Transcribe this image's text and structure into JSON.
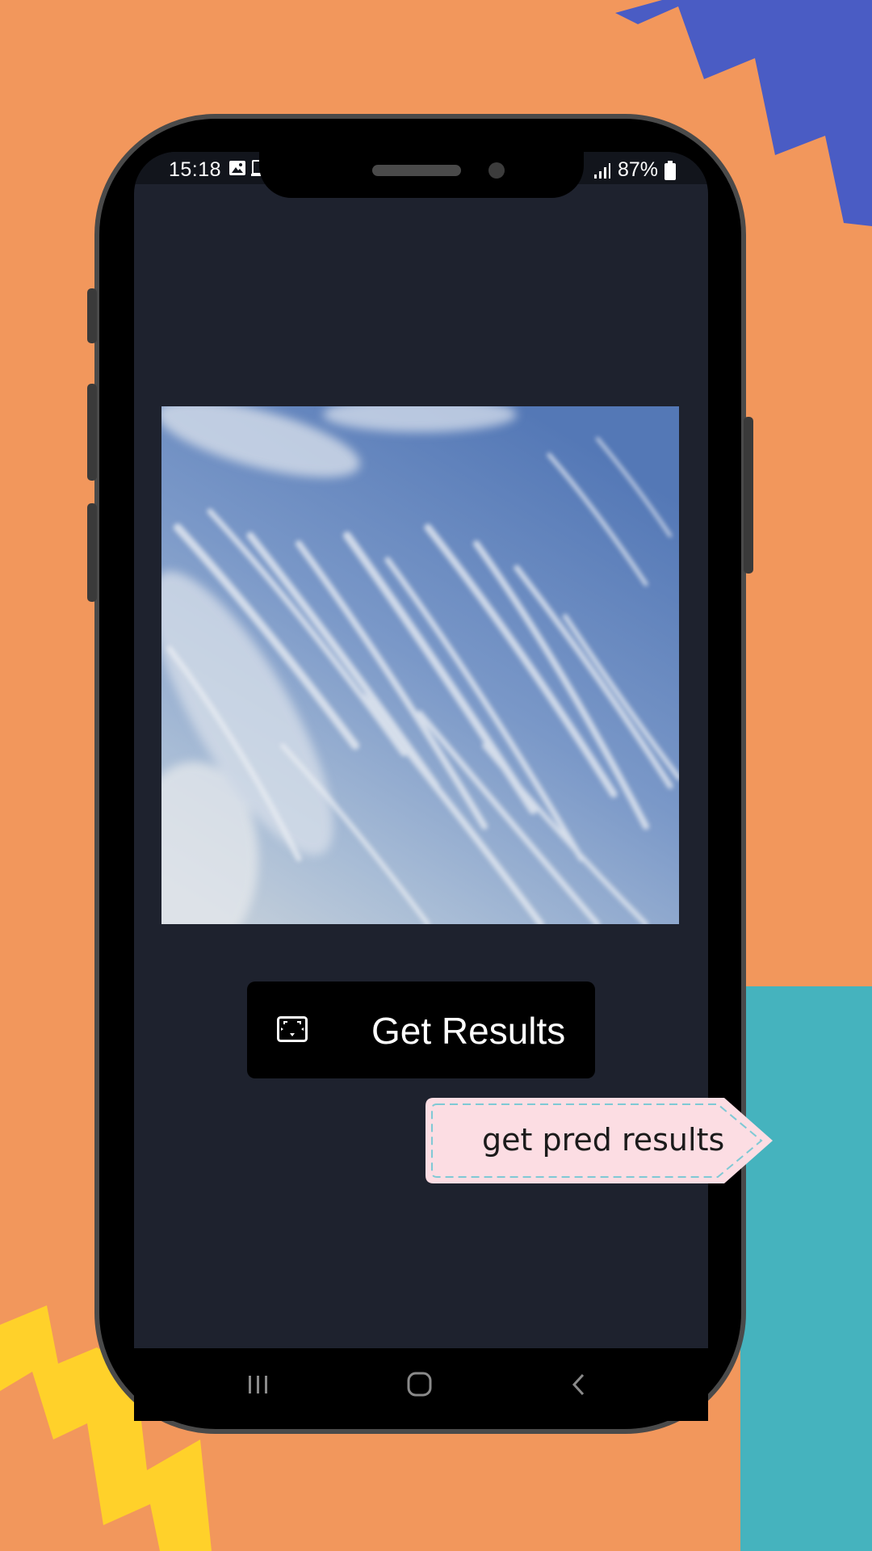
{
  "status_bar": {
    "time": "15:18",
    "battery": "87%",
    "left_icons": [
      "image-icon",
      "screenshot-icon"
    ],
    "right_icons": [
      "volte-icon",
      "signal-icon",
      "battery-icon"
    ]
  },
  "main": {
    "image": {
      "description_icon": "sky-photo"
    },
    "get_results_button": {
      "label": "Get Results",
      "icon": "fullscreen-icon"
    }
  },
  "tooltip": {
    "text": "get pred results"
  },
  "navigation": {
    "items": [
      "recent-apps-icon",
      "home-icon",
      "back-icon"
    ]
  },
  "colors": {
    "background": "#F2975C",
    "teal_accent": "#45B3BE",
    "blue_accent": "#4A5CC4",
    "yellow_accent": "#FFD12A",
    "screen_background": "#1E222E",
    "button_background": "#000000",
    "tooltip_background": "#FCDDE3",
    "tooltip_dash": "#7FC9D5"
  }
}
